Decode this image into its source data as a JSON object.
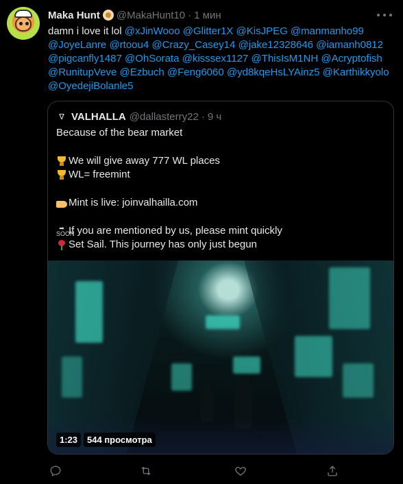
{
  "author": {
    "name": "Maka Hunt",
    "handle": "@MakaHunt10",
    "separator": "·",
    "time": "1 мин"
  },
  "tweet": {
    "text_plain": "damn i love it lol",
    "mentions": [
      "@xJinWooo",
      "@Glitter1X",
      "@KisJPEG",
      "@manmanho99",
      "@JoyeLanre",
      "@rtoou4",
      "@Crazy_Casey14",
      "@jake12328646",
      "@iamanh0812",
      "@pigcanfly1487",
      "@OhSorata",
      "@kisssex1127",
      "@ThisIsM1NH",
      "@Acryptofish",
      "@RunitupVeve",
      "@Ezbuch",
      "@Feng6060",
      "@yd8kqeHsLYAinz5",
      "@Karthikkyolo",
      "@OyedejiBolanle5"
    ]
  },
  "quote": {
    "name": "VALHALLA",
    "handle": "@dallasterry22",
    "separator": "·",
    "time": "9 ч",
    "lines": [
      "Because of the bear market",
      "",
      "We will give away 777 WL places",
      "WL= freemint",
      "",
      "Mint is live: joinvalhailla.com",
      "",
      "If you are mentioned by us, please mint quickly",
      "Set Sail. This journey has only just begun"
    ],
    "emoji_soon_label": "SOON"
  },
  "video": {
    "duration": "1:23",
    "views": "544 просмотра"
  },
  "icons": {
    "reply": "reply-icon",
    "retweet": "retweet-icon",
    "like": "heart-icon",
    "share": "share-icon",
    "more": "more-icon"
  },
  "colors": {
    "background": "#000000",
    "text": "#e7e9ea",
    "muted": "#71767b",
    "link": "#1d9bf0",
    "border": "#2f3336"
  }
}
